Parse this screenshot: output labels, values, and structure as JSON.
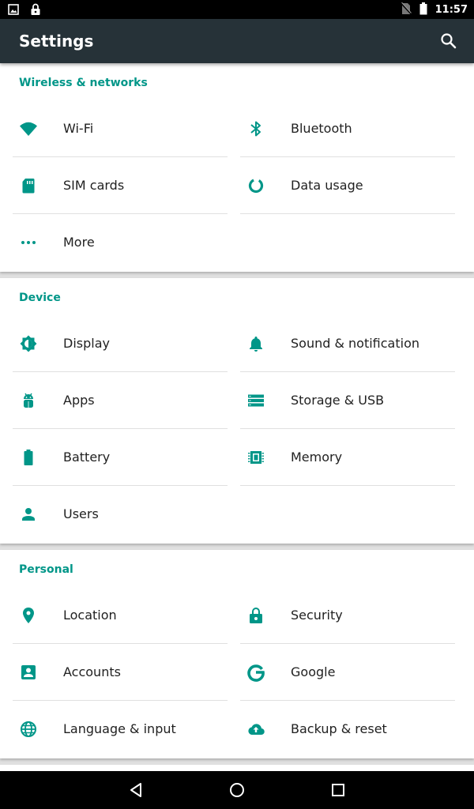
{
  "status_bar": {
    "time": "11:57",
    "icons_left": [
      "image-notification-icon",
      "lock-icon"
    ],
    "icons_right": [
      "no-sim-icon",
      "battery-icon"
    ]
  },
  "app_bar": {
    "title": "Settings",
    "search_icon": "search-icon"
  },
  "colors": {
    "accent": "#009688",
    "app_bar": "#263238",
    "status_bar": "#000000"
  },
  "sections": [
    {
      "title": "Wireless & networks",
      "items": [
        {
          "label": "Wi-Fi",
          "icon": "wifi-icon"
        },
        {
          "label": "Bluetooth",
          "icon": "bluetooth-icon"
        },
        {
          "label": "SIM cards",
          "icon": "sim-card-icon"
        },
        {
          "label": "Data usage",
          "icon": "data-usage-icon"
        },
        {
          "label": "More",
          "icon": "more-dots-icon"
        }
      ]
    },
    {
      "title": "Device",
      "items": [
        {
          "label": "Display",
          "icon": "brightness-icon"
        },
        {
          "label": "Sound & notification",
          "icon": "bell-icon"
        },
        {
          "label": "Apps",
          "icon": "android-icon"
        },
        {
          "label": "Storage & USB",
          "icon": "storage-icon"
        },
        {
          "label": "Battery",
          "icon": "battery-icon"
        },
        {
          "label": "Memory",
          "icon": "memory-chip-icon"
        },
        {
          "label": "Users",
          "icon": "person-icon"
        }
      ]
    },
    {
      "title": "Personal",
      "items": [
        {
          "label": "Location",
          "icon": "location-pin-icon"
        },
        {
          "label": "Security",
          "icon": "lock-icon"
        },
        {
          "label": "Accounts",
          "icon": "account-box-icon"
        },
        {
          "label": "Google",
          "icon": "google-g-icon"
        },
        {
          "label": "Language & input",
          "icon": "globe-icon"
        },
        {
          "label": "Backup & reset",
          "icon": "cloud-upload-icon"
        }
      ]
    }
  ],
  "nav_bar": {
    "buttons": [
      "back-icon",
      "home-icon",
      "recents-icon"
    ]
  }
}
